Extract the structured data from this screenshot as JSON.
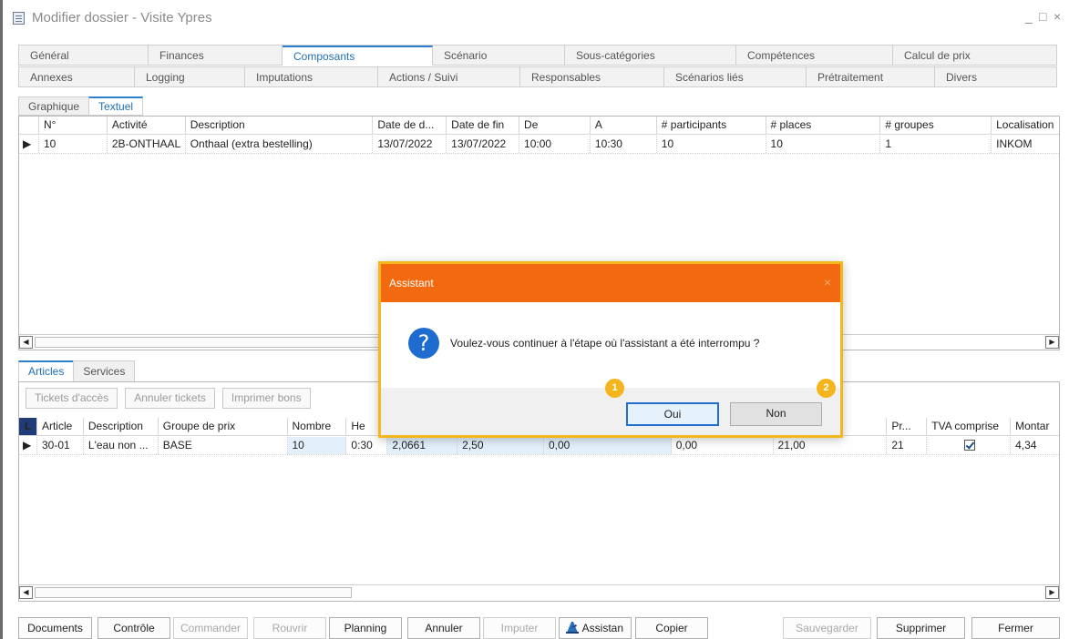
{
  "window": {
    "title": "Modifier dossier - Visite Ypres",
    "controls": {
      "minimize": "_",
      "maximize": "□",
      "close": "×"
    }
  },
  "tabs_row1": [
    "Général",
    "Finances",
    "Composants",
    "Scénario",
    "Sous-catégories",
    "Compétences",
    "Calcul de prix"
  ],
  "tabs_row2": [
    "Annexes",
    "Logging",
    "Imputations",
    "Actions / Suivi",
    "Responsables",
    "Scénarios liés",
    "Prétraitement",
    "Divers"
  ],
  "view_tabs": [
    "Graphique",
    "Textuel"
  ],
  "activities": {
    "columns": [
      "N°",
      "Activité",
      "Description",
      "Date de d...",
      "Date de fin",
      "De",
      "A",
      "# participants",
      "# places",
      "# groupes",
      "Localisation"
    ],
    "row": {
      "indicator": "▶",
      "values": [
        "10",
        "2B-ONTHAAL",
        "Onthaal (extra bestelling)",
        "13/07/2022",
        "13/07/2022",
        "10:00",
        "10:30",
        "10",
        "10",
        "1",
        "INKOM"
      ]
    },
    "scroll_left": "◀",
    "scroll_right": "▶"
  },
  "detail_tabs": [
    "Articles",
    "Services"
  ],
  "toolbar": [
    "Tickets d'accès",
    "Annuler tickets",
    "Imprimer bons"
  ],
  "articles": {
    "badge": "L",
    "columns": [
      "Article",
      "Description",
      "Groupe de prix",
      "Nombre",
      "He",
      "Pr...",
      "TVA comprise",
      "Montar"
    ],
    "row": {
      "indicator": "▶",
      "values": [
        "30-01",
        "L'eau non ...",
        "BASE",
        "10",
        "0:30",
        "2,0661",
        "2,50",
        "0,00",
        "0,00",
        "21,00",
        "21",
        "",
        "4,34"
      ]
    },
    "scroll_left": "◀",
    "scroll_right": "▶"
  },
  "bottom_buttons": {
    "documents": "Documents",
    "controle": "Contrôle",
    "commander": "Commander",
    "rouvrir": "Rouvrir",
    "planning": "Planning",
    "annuler": "Annuler",
    "imputer": "Imputer",
    "assistant": "Assistan",
    "copier": "Copier",
    "sauvegarder": "Sauvegarder",
    "supprimer": "Supprimer",
    "fermer": "Fermer"
  },
  "dialog": {
    "title": "Assistant",
    "close": "×",
    "icon": "?",
    "message": "Voulez-vous continuer à l'étape où l'assistant a été interrompu ?",
    "yes": "Oui",
    "no": "Non",
    "marker1": "1",
    "marker2": "2"
  },
  "colors": {
    "dialog_title": "#f2690f",
    "dialog_frame": "#f2b81c",
    "active_tab": "#2b7dd1",
    "badge": "#1f3c78"
  }
}
